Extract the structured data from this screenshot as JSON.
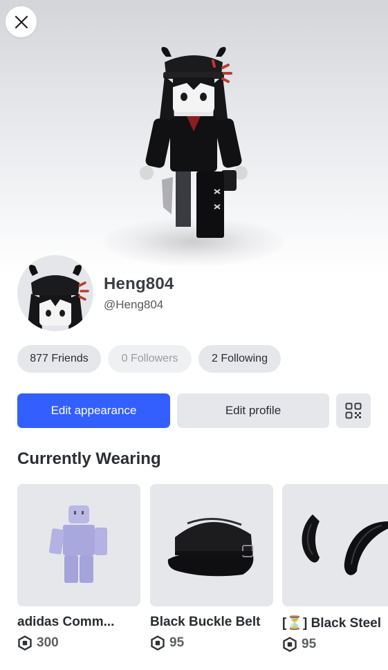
{
  "profile": {
    "display_name": "Heng804",
    "username": "@Heng804"
  },
  "stats": {
    "friends": "877 Friends",
    "followers": "0 Followers",
    "following": "2 Following"
  },
  "actions": {
    "edit_appearance": "Edit appearance",
    "edit_profile": "Edit profile"
  },
  "wearing": {
    "title": "Currently Wearing",
    "items": [
      {
        "name": "adidas Comm...",
        "price": "300",
        "icon": "blocky-body-icon"
      },
      {
        "name": "Black Buckle Belt",
        "price": "95",
        "icon": "black-cap-icon"
      },
      {
        "name": "[⏳] Black Steel",
        "price": "95",
        "icon": "black-horns-icon"
      }
    ]
  },
  "colors": {
    "primary": "#335fff",
    "pill": "#e6e7eb"
  }
}
